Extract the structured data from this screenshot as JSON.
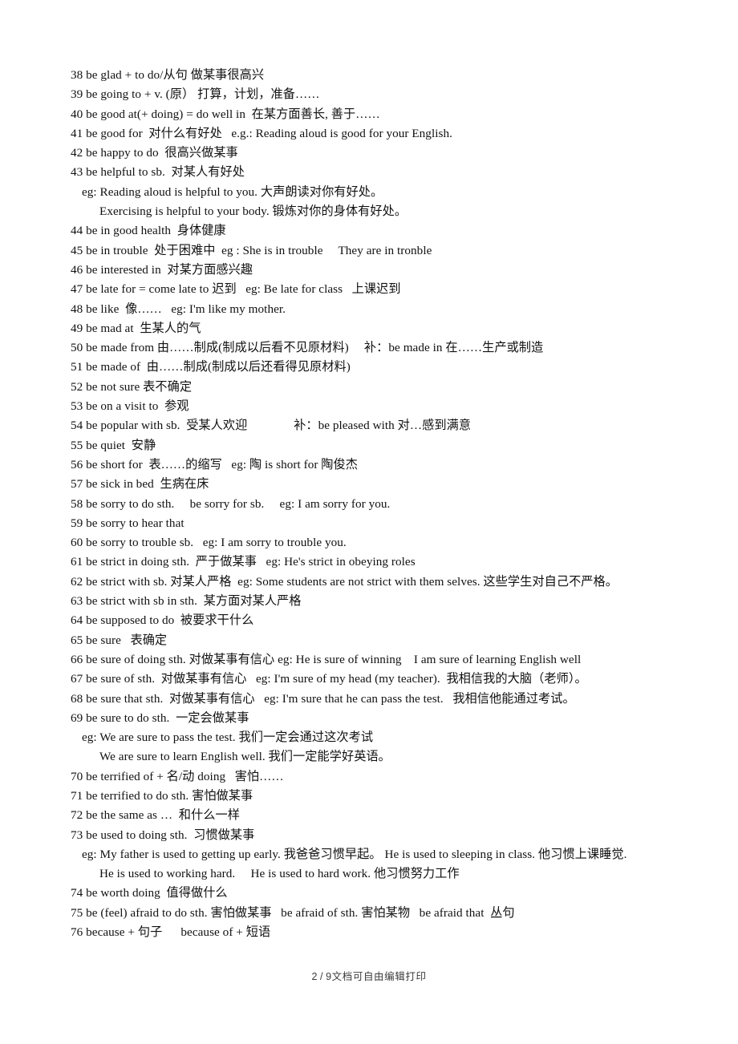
{
  "document": {
    "page_label": "2",
    "page_separator": "/",
    "page_total": "9",
    "footer_note": "文档可自由编辑打印",
    "lines": [
      {
        "indent": 0,
        "text": "38 be glad + to do/从句 做某事很高兴"
      },
      {
        "indent": 0,
        "text": "39 be going to + v. (原） 打算，计划，准备……"
      },
      {
        "indent": 0,
        "text": "40 be good at(+ doing) = do well in  在某方面善长, 善于……"
      },
      {
        "indent": 0,
        "text": "41 be good for  对什么有好处   e.g.: Reading aloud is good for your English."
      },
      {
        "indent": 0,
        "text": "42 be happy to do  很高兴做某事"
      },
      {
        "indent": 0,
        "text": "43 be helpful to sb.  对某人有好处"
      },
      {
        "indent": 1,
        "text": "eg: Reading aloud is helpful to you. 大声朗读对你有好处。"
      },
      {
        "indent": 2,
        "text": "Exercising is helpful to your body. 锻炼对你的身体有好处。"
      },
      {
        "indent": 0,
        "text": "44 be in good health  身体健康"
      },
      {
        "indent": 0,
        "text": "45 be in trouble  处于困难中  eg : She is in trouble     They are in tronble"
      },
      {
        "indent": 0,
        "text": "46 be interested in  对某方面感兴趣"
      },
      {
        "indent": 0,
        "text": "47 be late for = come late to 迟到   eg: Be late for class   上课迟到"
      },
      {
        "indent": 0,
        "text": "48 be like  像……   eg: I'm like my mother."
      },
      {
        "indent": 0,
        "text": "49 be mad at  生某人的气"
      },
      {
        "indent": 0,
        "text": "50 be made from 由……制成(制成以后看不见原材料)     补：be made in 在……生产或制造"
      },
      {
        "indent": 0,
        "text": "51 be made of  由……制成(制成以后还看得见原材料)"
      },
      {
        "indent": 0,
        "text": "52 be not sure 表不确定"
      },
      {
        "indent": 0,
        "text": "53 be on a visit to  参观"
      },
      {
        "indent": 0,
        "text": "54 be popular with sb.  受某人欢迎               补：be pleased with 对…感到满意"
      },
      {
        "indent": 0,
        "text": "55 be quiet  安静"
      },
      {
        "indent": 0,
        "text": "56 be short for  表……的缩写   eg: 陶 is short for 陶俊杰"
      },
      {
        "indent": 0,
        "text": "57 be sick in bed  生病在床"
      },
      {
        "indent": 0,
        "text": "58 be sorry to do sth.     be sorry for sb.     eg: I am sorry for you."
      },
      {
        "indent": 0,
        "text": "59 be sorry to hear that"
      },
      {
        "indent": 0,
        "text": "60 be sorry to trouble sb.   eg: I am sorry to trouble you."
      },
      {
        "indent": 0,
        "text": "61 be strict in doing sth.  严于做某事   eg: He's strict in obeying roles"
      },
      {
        "indent": 0,
        "text": "62 be strict with sb. 对某人严格  eg: Some students are not strict with them selves. 这些学生对自己不严格。"
      },
      {
        "indent": 0,
        "text": "63 be strict with sb in sth.  某方面对某人严格"
      },
      {
        "indent": 0,
        "text": "64 be supposed to do  被要求干什么"
      },
      {
        "indent": 0,
        "text": "65 be sure   表确定"
      },
      {
        "indent": 0,
        "text": "66 be sure of doing sth. 对做某事有信心 eg: He is sure of winning    I am sure of learning English well"
      },
      {
        "indent": 0,
        "text": "67 be sure of sth.  对做某事有信心   eg: I'm sure of my head (my teacher).  我相信我的大脑（老师）。"
      },
      {
        "indent": 0,
        "text": "68 be sure that sth.  对做某事有信心   eg: I'm sure that he can pass the test.   我相信他能通过考试。"
      },
      {
        "indent": 0,
        "text": "69 be sure to do sth.  一定会做某事"
      },
      {
        "indent": 1,
        "text": "eg: We are sure to pass the test. 我们一定会通过这次考试"
      },
      {
        "indent": 2,
        "text": "We are sure to learn English well. 我们一定能学好英语。"
      },
      {
        "indent": 0,
        "text": "70 be terrified of + 名/动 doing   害怕……"
      },
      {
        "indent": 0,
        "text": "71 be terrified to do sth. 害怕做某事"
      },
      {
        "indent": 0,
        "text": "72 be the same as …  和什么一样"
      },
      {
        "indent": 0,
        "text": "73 be used to doing sth.  习惯做某事"
      },
      {
        "indent": 1,
        "wrap": true,
        "text": "eg: My father is used to getting up early. 我爸爸习惯早起。    He is used to sleeping in class.  他习惯上课睡觉."
      },
      {
        "indent": 2,
        "text": "He is used to working hard.     He is used to hard work. 他习惯努力工作"
      },
      {
        "indent": 0,
        "text": "74 be worth doing  值得做什么"
      },
      {
        "indent": 0,
        "text": "75 be (feel) afraid to do sth. 害怕做某事   be afraid of sth. 害怕某物   be afraid that  丛句"
      },
      {
        "indent": 0,
        "text": "76 because + 句子      because of + 短语"
      }
    ]
  }
}
